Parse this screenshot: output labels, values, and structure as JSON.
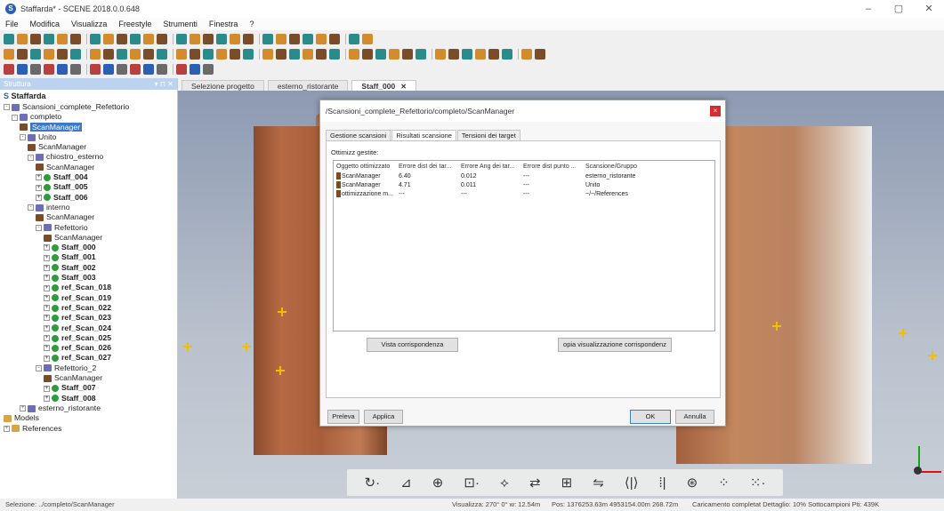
{
  "window": {
    "title": "Staffarda* - SCENE 2018.0.0.648",
    "app_badge": "S",
    "controls": [
      "–",
      "▢",
      "✕"
    ]
  },
  "menu": [
    "File",
    "Modifica",
    "Visualizza",
    "Freestyle",
    "Strumenti",
    "Finestra",
    "?"
  ],
  "left_panel": {
    "header": "Struttura",
    "header_controls": "▾ ⊓ ✕",
    "root": "Staffarda",
    "items": [
      {
        "label": "Scansioni_complete_Refettorio",
        "level": 0,
        "icon": "group",
        "expand": "-"
      },
      {
        "label": "completo",
        "level": 1,
        "icon": "group",
        "expand": "-"
      },
      {
        "label": "ScanManager",
        "level": 2,
        "icon": "scanmanager",
        "selected": true
      },
      {
        "label": "Unito",
        "level": 2,
        "icon": "group",
        "expand": "-"
      },
      {
        "label": "ScanManager",
        "level": 3,
        "icon": "scanmanager"
      },
      {
        "label": "chiostro_esterno",
        "level": 3,
        "icon": "group",
        "expand": "-"
      },
      {
        "label": "ScanManager",
        "level": 4,
        "icon": "scanmanager"
      },
      {
        "label": "Staff_004",
        "level": 4,
        "icon": "scan",
        "expand": "+",
        "bold": true
      },
      {
        "label": "Staff_005",
        "level": 4,
        "icon": "scan",
        "expand": "+",
        "bold": true
      },
      {
        "label": "Staff_006",
        "level": 4,
        "icon": "scan",
        "expand": "+",
        "bold": true
      },
      {
        "label": "interno",
        "level": 3,
        "icon": "group",
        "expand": "-"
      },
      {
        "label": "ScanManager",
        "level": 4,
        "icon": "scanmanager"
      },
      {
        "label": "Refettorio",
        "level": 4,
        "icon": "group",
        "expand": "-"
      },
      {
        "label": "ScanManager",
        "level": 5,
        "icon": "scanmanager"
      },
      {
        "label": "Staff_000",
        "level": 5,
        "icon": "scan",
        "expand": "+",
        "bold": true
      },
      {
        "label": "Staff_001",
        "level": 5,
        "icon": "scan",
        "expand": "+",
        "bold": true
      },
      {
        "label": "Staff_002",
        "level": 5,
        "icon": "scan",
        "expand": "+",
        "bold": true
      },
      {
        "label": "Staff_003",
        "level": 5,
        "icon": "scan",
        "expand": "+",
        "bold": true
      },
      {
        "label": "ref_Scan_018",
        "level": 5,
        "icon": "scan",
        "expand": "+",
        "bold": true
      },
      {
        "label": "ref_Scan_019",
        "level": 5,
        "icon": "scan",
        "expand": "+",
        "bold": true
      },
      {
        "label": "ref_Scan_022",
        "level": 5,
        "icon": "scan",
        "expand": "+",
        "bold": true
      },
      {
        "label": "ref_Scan_023",
        "level": 5,
        "icon": "scan",
        "expand": "+",
        "bold": true
      },
      {
        "label": "ref_Scan_024",
        "level": 5,
        "icon": "scan",
        "expand": "+",
        "bold": true
      },
      {
        "label": "ref_Scan_025",
        "level": 5,
        "icon": "scan",
        "expand": "+",
        "bold": true
      },
      {
        "label": "ref_Scan_026",
        "level": 5,
        "icon": "scan",
        "expand": "+",
        "bold": true
      },
      {
        "label": "ref_Scan_027",
        "level": 5,
        "icon": "scan",
        "expand": "+",
        "bold": true
      },
      {
        "label": "Refettorio_2",
        "level": 4,
        "icon": "group",
        "expand": "-"
      },
      {
        "label": "ScanManager",
        "level": 5,
        "icon": "scanmanager"
      },
      {
        "label": "Staff_007",
        "level": 5,
        "icon": "scan",
        "expand": "+",
        "bold": true
      },
      {
        "label": "Staff_008",
        "level": 5,
        "icon": "scan",
        "expand": "+",
        "bold": true
      },
      {
        "label": "esterno_ristorante",
        "level": 2,
        "icon": "group",
        "expand": "+"
      },
      {
        "label": "Models",
        "level": 0,
        "icon": "folder"
      },
      {
        "label": "References",
        "level": 0,
        "icon": "folder",
        "expand": "+"
      }
    ]
  },
  "doc_tabs": [
    {
      "label": "Selezione progetto",
      "active": false
    },
    {
      "label": "esterno_ristorante",
      "active": false
    },
    {
      "label": "Staff_000",
      "active": true,
      "close": "✕"
    }
  ],
  "dialog": {
    "title": "/Scansioni_complete_Refettorio/completo/ScanManager",
    "close": "×",
    "tabs": [
      "Gestione scansioni",
      "Risultati scansione",
      "Tensioni dei target"
    ],
    "active_tab": "Risultati scansione",
    "section": "Ottimizz gestite:",
    "columns": [
      "Oggetto ottimizzato",
      "Errore dist dei tar...",
      "Errore Ang dei tar...",
      "Errore dist punto ...",
      "Scansione/Gruppo"
    ],
    "rows": [
      [
        "ScanManager",
        "6.40",
        "0.012",
        "---",
        "esterno_ristorante"
      ],
      [
        "ScanManager",
        "4.71",
        "0.011",
        "---",
        "Unito"
      ],
      [
        "ottimizzazione m...",
        "---",
        "---",
        "---",
        "~/~/References"
      ]
    ],
    "btn_match_view": "Vista corrispondenza",
    "btn_copy_view": "opia visualizzazione corrispondenz",
    "btn_preleva": "Preleva",
    "btn_applica": "Applica",
    "btn_ok": "OK",
    "btn_annulla": "Annulla"
  },
  "nav_icons": [
    "↻·",
    "⊿",
    "⊕",
    "⊡·",
    "⟡",
    "⇄",
    "⊞",
    "⇋",
    "⟨|⟩",
    "⁞|",
    "⊛",
    "⁘",
    "⁙·"
  ],
  "status": {
    "left": "Selezione: ../completo/ScanManager",
    "view": "Visualizza: 270° 0° w: 12.54m",
    "pos": "Pos: 1376253.63m 4953154.00m 268.72m",
    "load": "Caricamento completat Dettaglio: 10% Sottocampioni Pti: 439K"
  }
}
